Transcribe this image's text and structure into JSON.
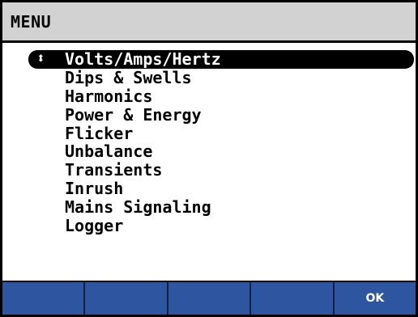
{
  "header": {
    "title": "MENU"
  },
  "menu": {
    "selected_icon": "updown-arrows-icon",
    "items": [
      {
        "label": "Volts/Amps/Hertz",
        "selected": true
      },
      {
        "label": "Dips & Swells",
        "selected": false
      },
      {
        "label": "Harmonics",
        "selected": false
      },
      {
        "label": "Power & Energy",
        "selected": false
      },
      {
        "label": "Flicker",
        "selected": false
      },
      {
        "label": "Unbalance",
        "selected": false
      },
      {
        "label": "Transients",
        "selected": false
      },
      {
        "label": "Inrush",
        "selected": false
      },
      {
        "label": "Mains Signaling",
        "selected": false
      },
      {
        "label": "Logger",
        "selected": false
      }
    ]
  },
  "softkeys": [
    {
      "label": ""
    },
    {
      "label": ""
    },
    {
      "label": ""
    },
    {
      "label": ""
    },
    {
      "label": "OK"
    }
  ],
  "colors": {
    "header_bg": "#d2d2d2",
    "softkey_bg": "#2d55a0",
    "selected_bg": "#000000",
    "selected_fg": "#ffffff"
  }
}
